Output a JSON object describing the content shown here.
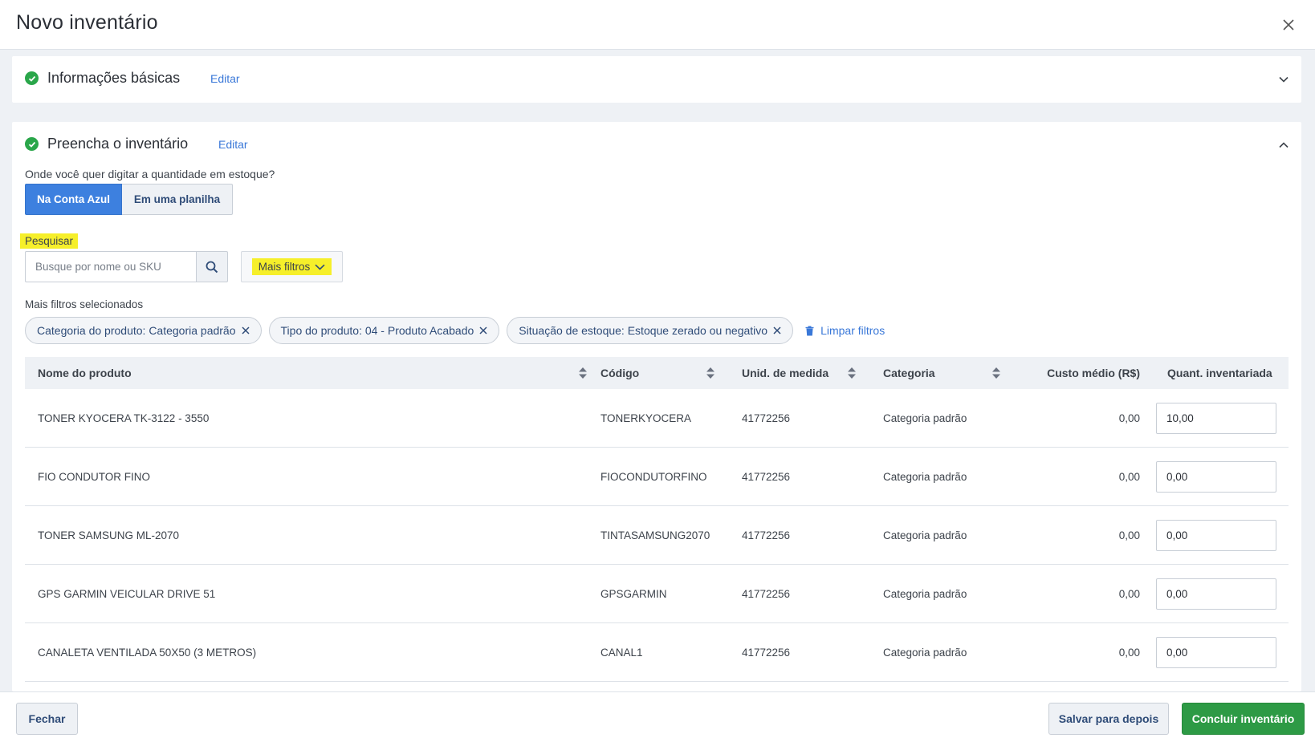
{
  "header": {
    "title": "Novo inventário",
    "close_icon": "close-icon"
  },
  "section_basic": {
    "title": "Informações básicas",
    "edit_label": "Editar",
    "status_icon": "check-circle-icon",
    "expand_icon": "chevron-down-icon"
  },
  "section_fill": {
    "title": "Preencha o inventário",
    "edit_label": "Editar",
    "status_icon": "check-circle-icon",
    "collapse_icon": "chevron-up-icon",
    "question": "Onde você quer digitar a quantidade em estoque?",
    "options": [
      {
        "label": "Na Conta Azul",
        "selected": true
      },
      {
        "label": "Em uma planilha",
        "selected": false
      }
    ],
    "search": {
      "label": "Pesquisar",
      "placeholder": "Busque por nome ou SKU",
      "value": "",
      "button_icon": "search-icon"
    },
    "more_filters_label": "Mais filtros",
    "selected_filters_label": "Mais filtros selecionados",
    "chips": [
      {
        "label": "Categoria do produto: Categoria padrão"
      },
      {
        "label": "Tipo do produto: 04 - Produto Acabado"
      },
      {
        "label": "Situação de estoque: Estoque zerado ou negativo"
      }
    ],
    "clear_filters_label": "Limpar filtros"
  },
  "table": {
    "columns": {
      "name": "Nome do produto",
      "code": "Código",
      "unit": "Unid. de medida",
      "category": "Categoria",
      "cost": "Custo médio (R$)",
      "qty": "Quant. inventariada"
    },
    "rows": [
      {
        "name": "TONER KYOCERA TK-3122 - 3550",
        "code": "TONERKYOCERA",
        "unit": "41772256",
        "category": "Categoria padrão",
        "cost": "0,00",
        "qty": "10,00"
      },
      {
        "name": "FIO CONDUTOR FINO",
        "code": "FIOCONDUTORFINO",
        "unit": "41772256",
        "category": "Categoria padrão",
        "cost": "0,00",
        "qty": "0,00"
      },
      {
        "name": "TONER SAMSUNG ML-2070",
        "code": "TINTASAMSUNG2070",
        "unit": "41772256",
        "category": "Categoria padrão",
        "cost": "0,00",
        "qty": "0,00"
      },
      {
        "name": "GPS GARMIN VEICULAR DRIVE 51",
        "code": "GPSGARMIN",
        "unit": "41772256",
        "category": "Categoria padrão",
        "cost": "0,00",
        "qty": "0,00"
      },
      {
        "name": "CANALETA VENTILADA 50X50 (3 METROS)",
        "code": "CANAL1",
        "unit": "41772256",
        "category": "Categoria padrão",
        "cost": "0,00",
        "qty": "0,00"
      }
    ]
  },
  "footer": {
    "close_label": "Fechar",
    "save_label": "Salvar para depois",
    "finish_label": "Concluir inventário"
  },
  "colors": {
    "primary": "#3d80df",
    "success": "#2d9a45",
    "highlight": "#f6ef2a",
    "link": "#3a78d8"
  }
}
